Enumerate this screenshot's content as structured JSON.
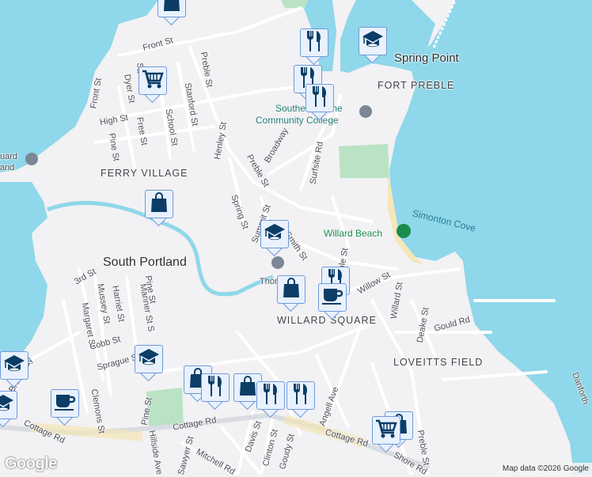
{
  "map": {
    "colors": {
      "water": "#8fd7ea",
      "land": "#f2f1f3",
      "park": "#b9e3c4",
      "road": "#ffffff",
      "road_major": "#d6d9de",
      "marker_bg": "#e8f1fd",
      "marker_icon": "#0b3d66"
    },
    "labels": [
      "Front St",
      "Preble St",
      "Sa",
      "Dyer St",
      "Front St",
      "High St",
      "Free St",
      "School St",
      "Stanford St",
      "Henley St",
      "Pine St",
      "Broadway",
      "Preble St",
      "Surfsite Rd",
      "Spring St",
      "Summit St",
      "Smith St",
      "Preble St",
      "Thom",
      "Willow St",
      "3rd St",
      "Mussey St",
      "Harriet St",
      "Mariner St S",
      "Pine St",
      "Margaret St",
      "Cobb St",
      "Willard St",
      "Deake St",
      "Gould Rd",
      "Sprague St",
      "Broadway",
      "Clemons St",
      "Pine St",
      "Cottage Rd",
      "Cottage Rd",
      "Cottage Rd",
      "Davis St",
      "Clinton St",
      "Goudy St",
      "Angell Ave",
      "Sawyer St",
      "Mitchell Rd",
      "Hillside Ave",
      "Preble St",
      "Shore Rd",
      "Danforth",
      "uard",
      "and"
    ],
    "areas": [
      "FERRY VILLAGE",
      "WILLARD SQUARE",
      "LOVEITTS FIELD",
      "FORT PREBLE"
    ],
    "city": "South Portland",
    "landmark": "Spring Point",
    "poi": [
      "Southern Maine",
      "Community College"
    ],
    "park_label": "Willard Beach",
    "water_label": "Simonton Cove",
    "markers": [
      "shopping-bag",
      "utensils",
      "graduation-cap",
      "shopping-cart",
      "utensils",
      "utensils",
      "shopping-bag",
      "graduation-cap",
      "utensils",
      "shopping-bag",
      "coffee",
      "graduation-cap",
      "graduation-cap",
      "graduation-cap",
      "coffee",
      "shopping-bag",
      "utensils",
      "shopping-bag",
      "utensils",
      "utensils",
      "shopping-bag",
      "shopping-cart"
    ],
    "logo": "Google",
    "credit": "Map data ©2026 Google"
  }
}
